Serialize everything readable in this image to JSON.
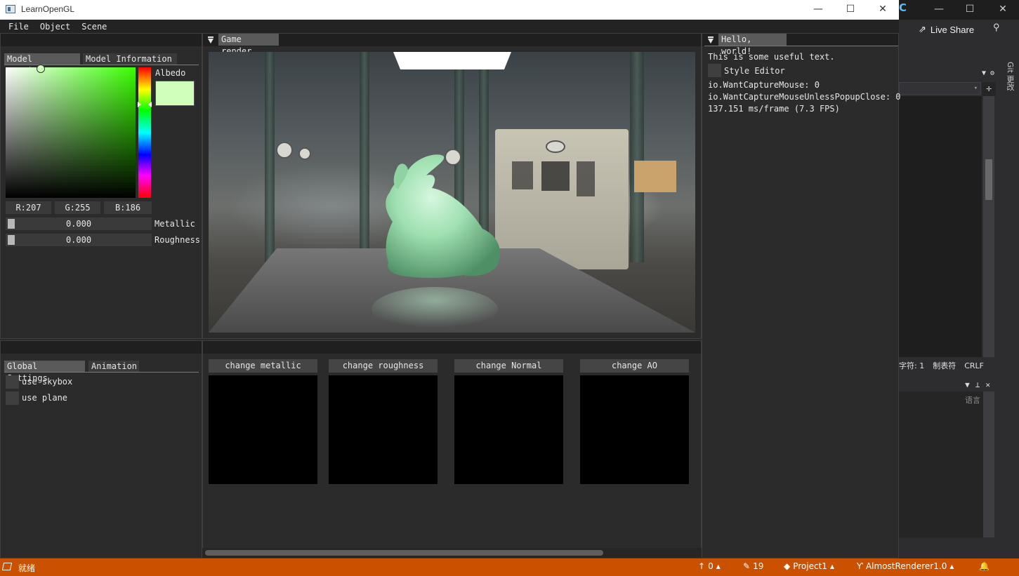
{
  "window": {
    "title": "LearnOpenGL"
  },
  "menu": [
    "File",
    "Object",
    "Scene"
  ],
  "left_top": {
    "tabs": [
      "Model Settings",
      "Model Information"
    ],
    "albedo_label": "Albedo",
    "albedo_color": "#cfffba",
    "rgb": [
      "R:207",
      "G:255",
      "B:186"
    ],
    "sliders": [
      {
        "value": "0.000",
        "label": "Metallic"
      },
      {
        "value": "0.000",
        "label": "Roughness"
      }
    ]
  },
  "left_bottom": {
    "tabs": [
      "Global Settings",
      "Animation"
    ],
    "checkboxes": [
      "use skybox",
      "use plane"
    ]
  },
  "center": {
    "tab": "Game render",
    "buttons": [
      "change metallic",
      "change roughness",
      "change Normal",
      "change AO"
    ]
  },
  "right": {
    "tab": "Hello, world!",
    "useful_text": "This is some useful text.",
    "style_editor": "Style Editor",
    "capture_mouse": "io.WantCaptureMouse: 0",
    "capture_popup": "io.WantCaptureMouseUnlessPopupClose: 0",
    "fps": "137.151 ms/frame (7.3 FPS)"
  },
  "vs": {
    "live_share": "Live Share",
    "git_tab": "Git 更改",
    "status_line": [
      "字符: 1",
      "制表符",
      "CRLF"
    ],
    "lang": "语言"
  },
  "status": {
    "ready": "就绪",
    "push": "0",
    "edits": "19",
    "project": "Project1",
    "branch": "AlmostRenderer1.0"
  },
  "colors": {
    "accent": "#ca5100",
    "model_color": "#cfffba"
  }
}
